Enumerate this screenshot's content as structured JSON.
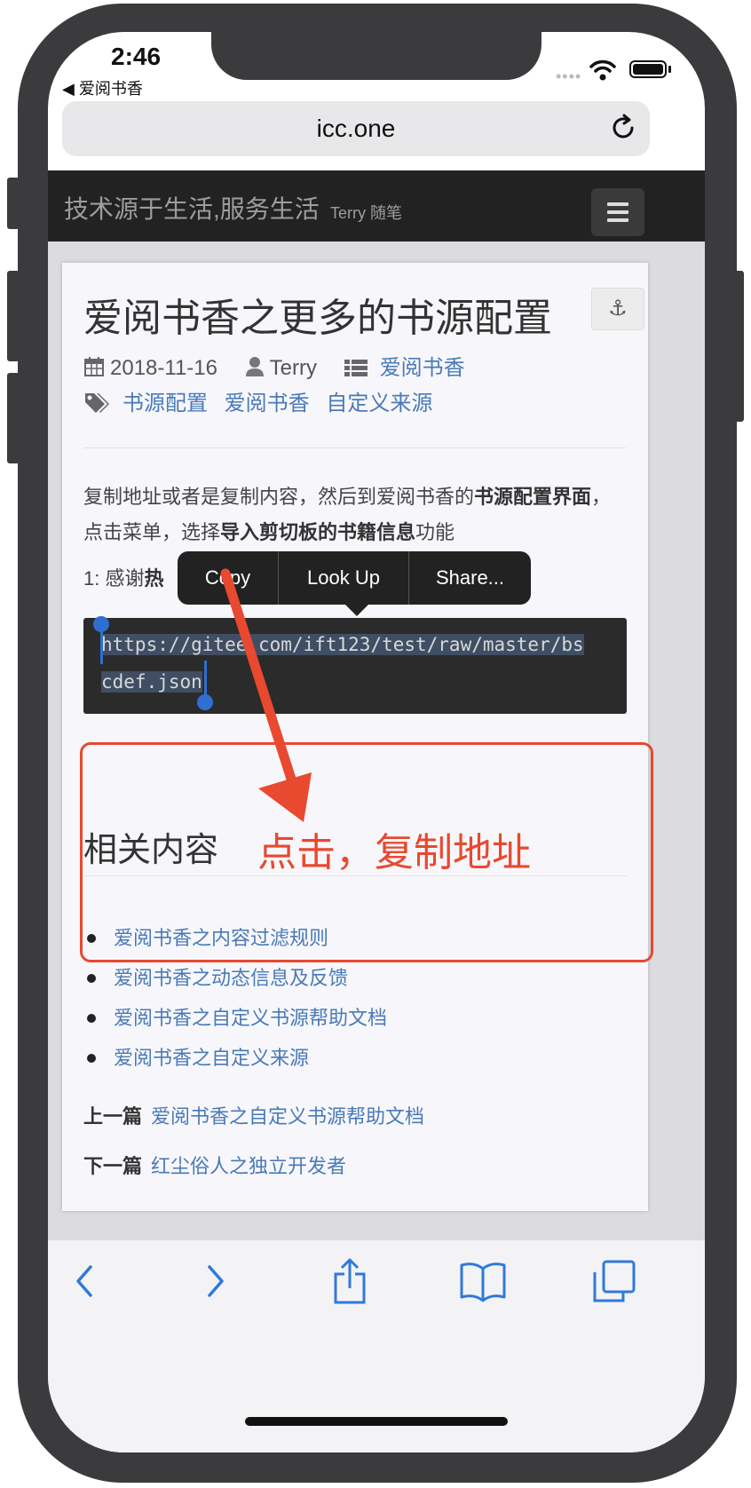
{
  "status": {
    "time": "2:46",
    "back_app": "◀ 爱阅书香"
  },
  "browser": {
    "url": "icc.one"
  },
  "site": {
    "title": "技术源于生活,服务生活",
    "subtitle": "Terry 随笔"
  },
  "post": {
    "title": "爱阅书香之更多的书源配置",
    "date": "2018-11-16",
    "author": "Terry",
    "category": "爱阅书香",
    "tags": [
      "书源配置",
      "爱阅书香",
      "自定义来源"
    ],
    "para1_a": "复制地址或者是复制内容，然后到爱阅书香的",
    "para1_b": "书源配置界面",
    "para1_c": "，点击菜单，选择",
    "para1_d": "导入剪切板的书籍信息",
    "para1_e": "功能",
    "thanks_prefix": "1: 感谢",
    "thanks_bold": "热",
    "code_line1": "https://gitee.com/ift123/test/raw/master/bs",
    "code_line2": "cdef.json"
  },
  "context_menu": {
    "copy": "Copy",
    "lookup": "Look Up",
    "share": "Share..."
  },
  "annotation": "点击，复制地址",
  "related": {
    "heading": "相关内容",
    "items": [
      "爱阅书香之内容过滤规则",
      "爱阅书香之动态信息及反馈",
      "爱阅书香之自定义书源帮助文档",
      "爱阅书香之自定义来源"
    ]
  },
  "nav": {
    "prev_label": "上一篇",
    "prev_title": "爱阅书香之自定义书源帮助文档",
    "next_label": "下一篇",
    "next_title": "红尘俗人之独立开发者"
  },
  "colors": {
    "accent_red": "#e8492f",
    "link": "#4a7ab7",
    "ios_blue": "#2f7ad9"
  }
}
